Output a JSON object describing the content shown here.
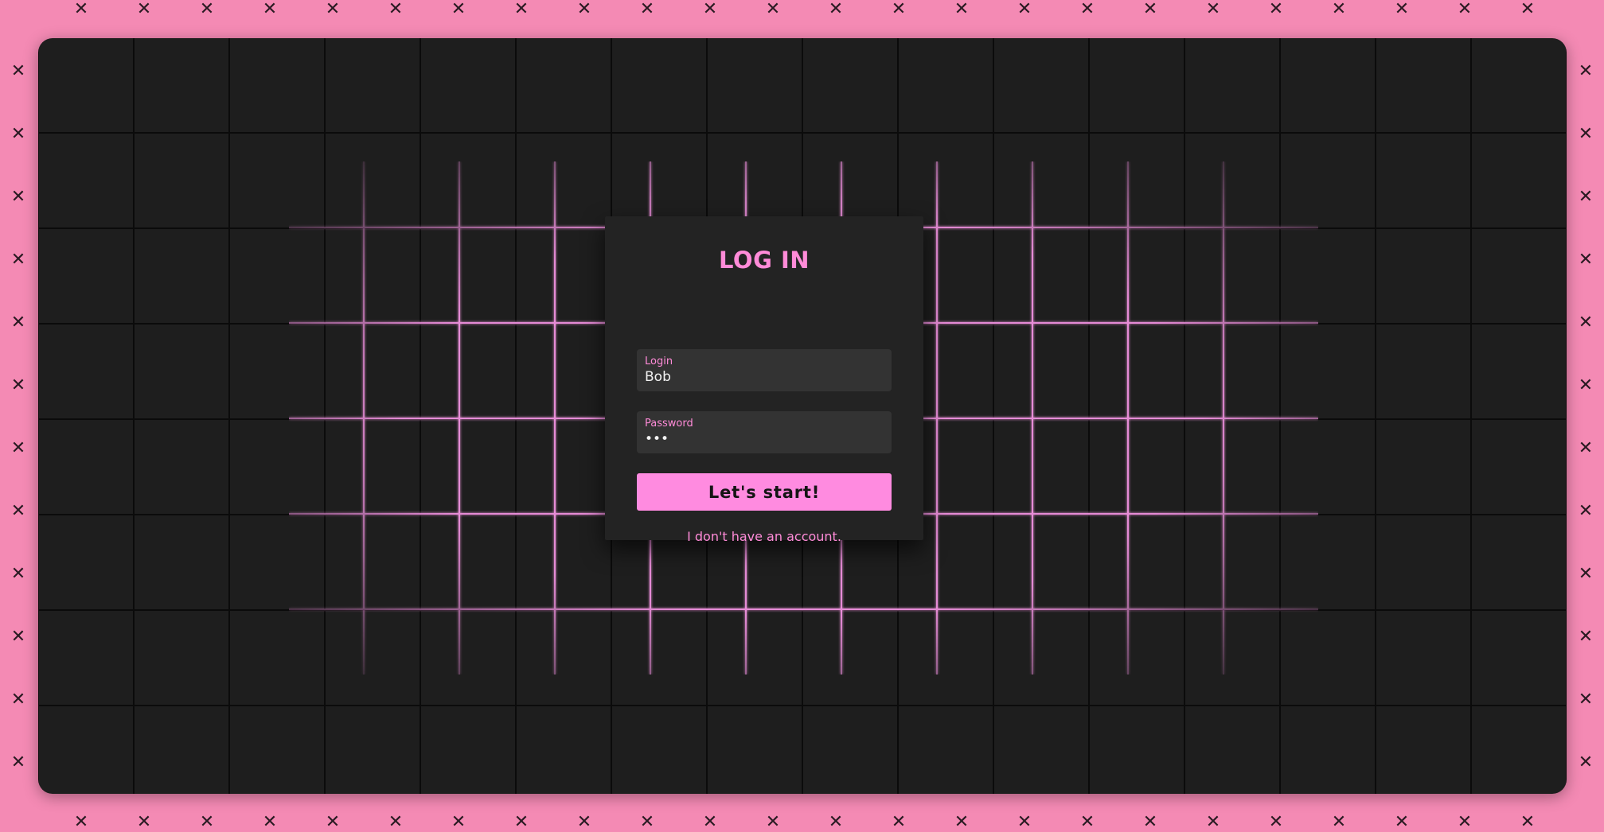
{
  "login_card": {
    "title": "LOG IN",
    "login_field": {
      "label": "Login",
      "value": "Bob"
    },
    "password_field": {
      "label": "Password",
      "value": "•••"
    },
    "submit_label": "Let's start!",
    "no_account_link": "I don't have an account."
  },
  "colors": {
    "accent": "#ff8bd8",
    "button": "#ff8be0",
    "border_background": "#f48ab4",
    "board_background": "#1e1e1e",
    "card_background": "#232323"
  },
  "icons": {
    "border_pattern": "x-mark-icon"
  }
}
